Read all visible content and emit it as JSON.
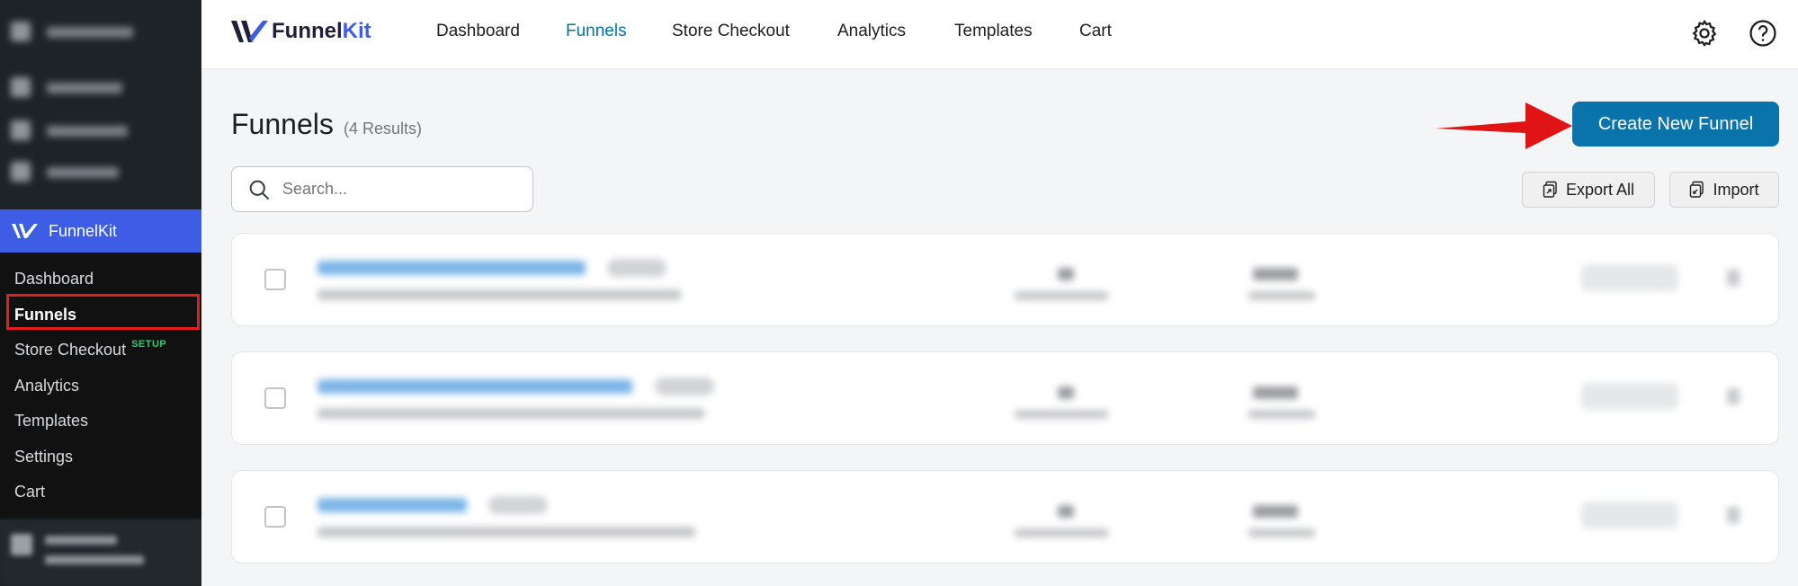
{
  "sidebar": {
    "brand": "FunnelKit",
    "items": [
      {
        "label": "Dashboard"
      },
      {
        "label": "Funnels"
      },
      {
        "label": "Store Checkout",
        "badge": "SETUP"
      },
      {
        "label": "Analytics"
      },
      {
        "label": "Templates"
      },
      {
        "label": "Settings"
      },
      {
        "label": "Cart"
      }
    ]
  },
  "topbar": {
    "logo_part1": "Funnel",
    "logo_part2": "Kit",
    "nav": [
      {
        "label": "Dashboard"
      },
      {
        "label": "Funnels",
        "active": true
      },
      {
        "label": "Store Checkout"
      },
      {
        "label": "Analytics"
      },
      {
        "label": "Templates"
      },
      {
        "label": "Cart"
      }
    ],
    "icons": [
      "gear-icon",
      "help-icon"
    ]
  },
  "main": {
    "title": "Funnels",
    "results": "(4 Results)",
    "create_button": "Create New Funnel",
    "search_placeholder": "Search...",
    "export_button": "Export All",
    "import_button": "Import"
  },
  "colors": {
    "sidebar_bg": "#1d2327",
    "brand_blue": "#3c5de4",
    "primary_button": "#0a73aa",
    "active_nav": "#0073aa",
    "highlight_red": "#e11d1d",
    "setup_badge": "#2ecc71"
  }
}
